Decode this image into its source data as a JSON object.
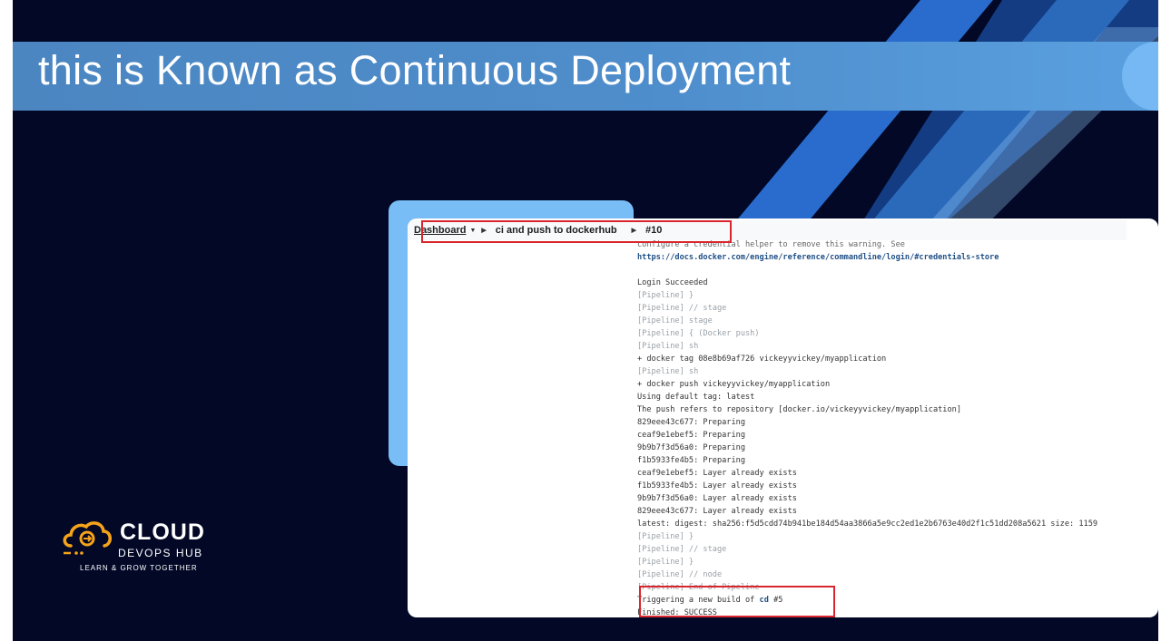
{
  "slide": {
    "title": "this is Known as Continuous Deployment"
  },
  "breadcrumb": {
    "dashboard": "Dashboard",
    "job": "ci and push to dockerhub",
    "build": "#10"
  },
  "log": {
    "lines": [
      {
        "text": "configure a credential helper to remove this warning. See",
        "style": "faded"
      },
      {
        "text": "https://docs.docker.com/engine/reference/commandline/login/#credentials-store",
        "style": "lnk"
      },
      {
        "text": "",
        "style": ""
      },
      {
        "text": "Login Succeeded",
        "style": ""
      },
      {
        "text": "[Pipeline] }",
        "style": "pl"
      },
      {
        "text": "[Pipeline] // stage",
        "style": "pl"
      },
      {
        "text": "[Pipeline] stage",
        "style": "pl"
      },
      {
        "text": "[Pipeline] { (Docker push)",
        "style": "pl"
      },
      {
        "text": "[Pipeline] sh",
        "style": "pl"
      },
      {
        "text": "+ docker tag 08e8b69af726 vickeyyvickey/myapplication",
        "style": ""
      },
      {
        "text": "[Pipeline] sh",
        "style": "pl"
      },
      {
        "text": "+ docker push vickeyyvickey/myapplication",
        "style": ""
      },
      {
        "text": "Using default tag: latest",
        "style": ""
      },
      {
        "text": "The push refers to repository [docker.io/vickeyyvickey/myapplication]",
        "style": ""
      },
      {
        "text": "829eee43c677: Preparing",
        "style": ""
      },
      {
        "text": "ceaf9e1ebef5: Preparing",
        "style": ""
      },
      {
        "text": "9b9b7f3d56a0: Preparing",
        "style": ""
      },
      {
        "text": "f1b5933fe4b5: Preparing",
        "style": ""
      },
      {
        "text": "ceaf9e1ebef5: Layer already exists",
        "style": ""
      },
      {
        "text": "f1b5933fe4b5: Layer already exists",
        "style": ""
      },
      {
        "text": "9b9b7f3d56a0: Layer already exists",
        "style": ""
      },
      {
        "text": "829eee43c677: Layer already exists",
        "style": ""
      },
      {
        "text": "latest: digest: sha256:f5d5cdd74b941be184d54aa3866a5e9cc2ed1e2b6763e40d2f1c51dd208a5621 size: 1159",
        "style": ""
      },
      {
        "text": "[Pipeline] }",
        "style": "pl"
      },
      {
        "text": "[Pipeline] // stage",
        "style": "pl"
      },
      {
        "text": "[Pipeline] }",
        "style": "pl"
      },
      {
        "text": "[Pipeline] // node",
        "style": "pl"
      },
      {
        "text": "[Pipeline] End of Pipeline",
        "style": "pl"
      }
    ],
    "trigger_prefix": "Triggering a new build of ",
    "trigger_job": "cd",
    "trigger_build": " #5",
    "finished": "Finished: SUCCESS"
  },
  "logo": {
    "word": "CLOUD",
    "sub": "DEVOPS HUB",
    "tagline": "LEARN & GROW TOGETHER"
  },
  "colors": {
    "background": "#020826",
    "title_band": "#4e8dcb",
    "card_accent": "#79bdf7",
    "highlight": "#d9262e",
    "logo_orange": "#f5a31a"
  }
}
